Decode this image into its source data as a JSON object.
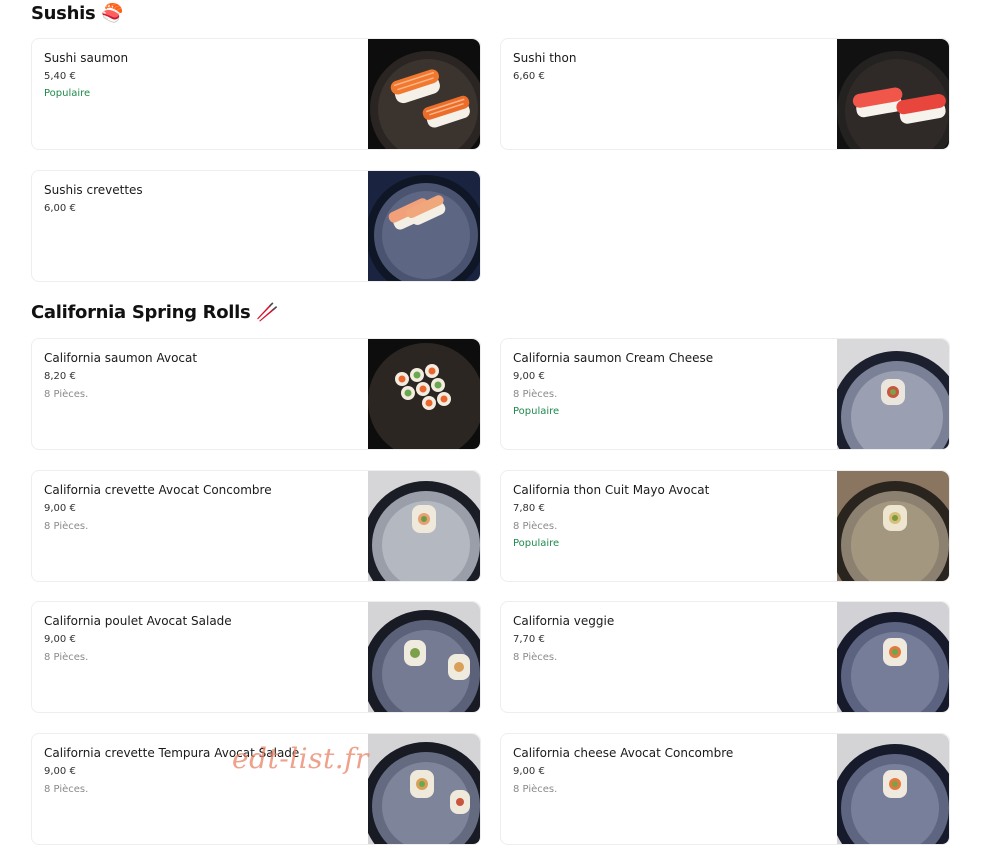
{
  "sections": [
    {
      "title": "Sushis",
      "emoji": "🍣",
      "items": [
        {
          "name": "Sushi saumon",
          "price": "5,40 €",
          "desc": "",
          "badge": "Populaire",
          "photo": "salmon-nigiri"
        },
        {
          "name": "Sushi thon",
          "price": "6,60 €",
          "desc": "",
          "badge": "",
          "photo": "tuna-nigiri"
        },
        {
          "name": "Sushis crevettes",
          "price": "6,00 €",
          "desc": "",
          "badge": "",
          "photo": "shrimp-nigiri"
        }
      ]
    },
    {
      "title": "California Spring Rolls",
      "emoji": "🥢",
      "items": [
        {
          "name": "California saumon Avocat",
          "price": "8,20 €",
          "desc": "8 Pièces.",
          "badge": "",
          "photo": "salmon-roll-platter"
        },
        {
          "name": "California saumon Cream Cheese",
          "price": "9,00 €",
          "desc": "8 Pièces.",
          "badge": "Populaire",
          "photo": "roll-single"
        },
        {
          "name": "California crevette Avocat Concombre",
          "price": "9,00 €",
          "desc": "8 Pièces.",
          "badge": "",
          "photo": "roll-single"
        },
        {
          "name": "California thon Cuit Mayo Avocat",
          "price": "7,80 €",
          "desc": "8 Pièces.",
          "badge": "Populaire",
          "photo": "roll-single-dark"
        },
        {
          "name": "California poulet Avocat Salade",
          "price": "9,00 €",
          "desc": "8 Pièces.",
          "badge": "",
          "photo": "roll-double"
        },
        {
          "name": "California veggie",
          "price": "7,70 €",
          "desc": "8 Pièces.",
          "badge": "",
          "photo": "roll-single"
        },
        {
          "name": "California crevette Tempura Avocat Salade",
          "price": "9,00 €",
          "desc": "8 Pièces.",
          "badge": "",
          "photo": "roll-double"
        },
        {
          "name": "California cheese Avocat Concombre",
          "price": "9,00 €",
          "desc": "8 Pièces.",
          "badge": "",
          "photo": "roll-single"
        }
      ]
    }
  ],
  "watermark": "edt-list.fr"
}
